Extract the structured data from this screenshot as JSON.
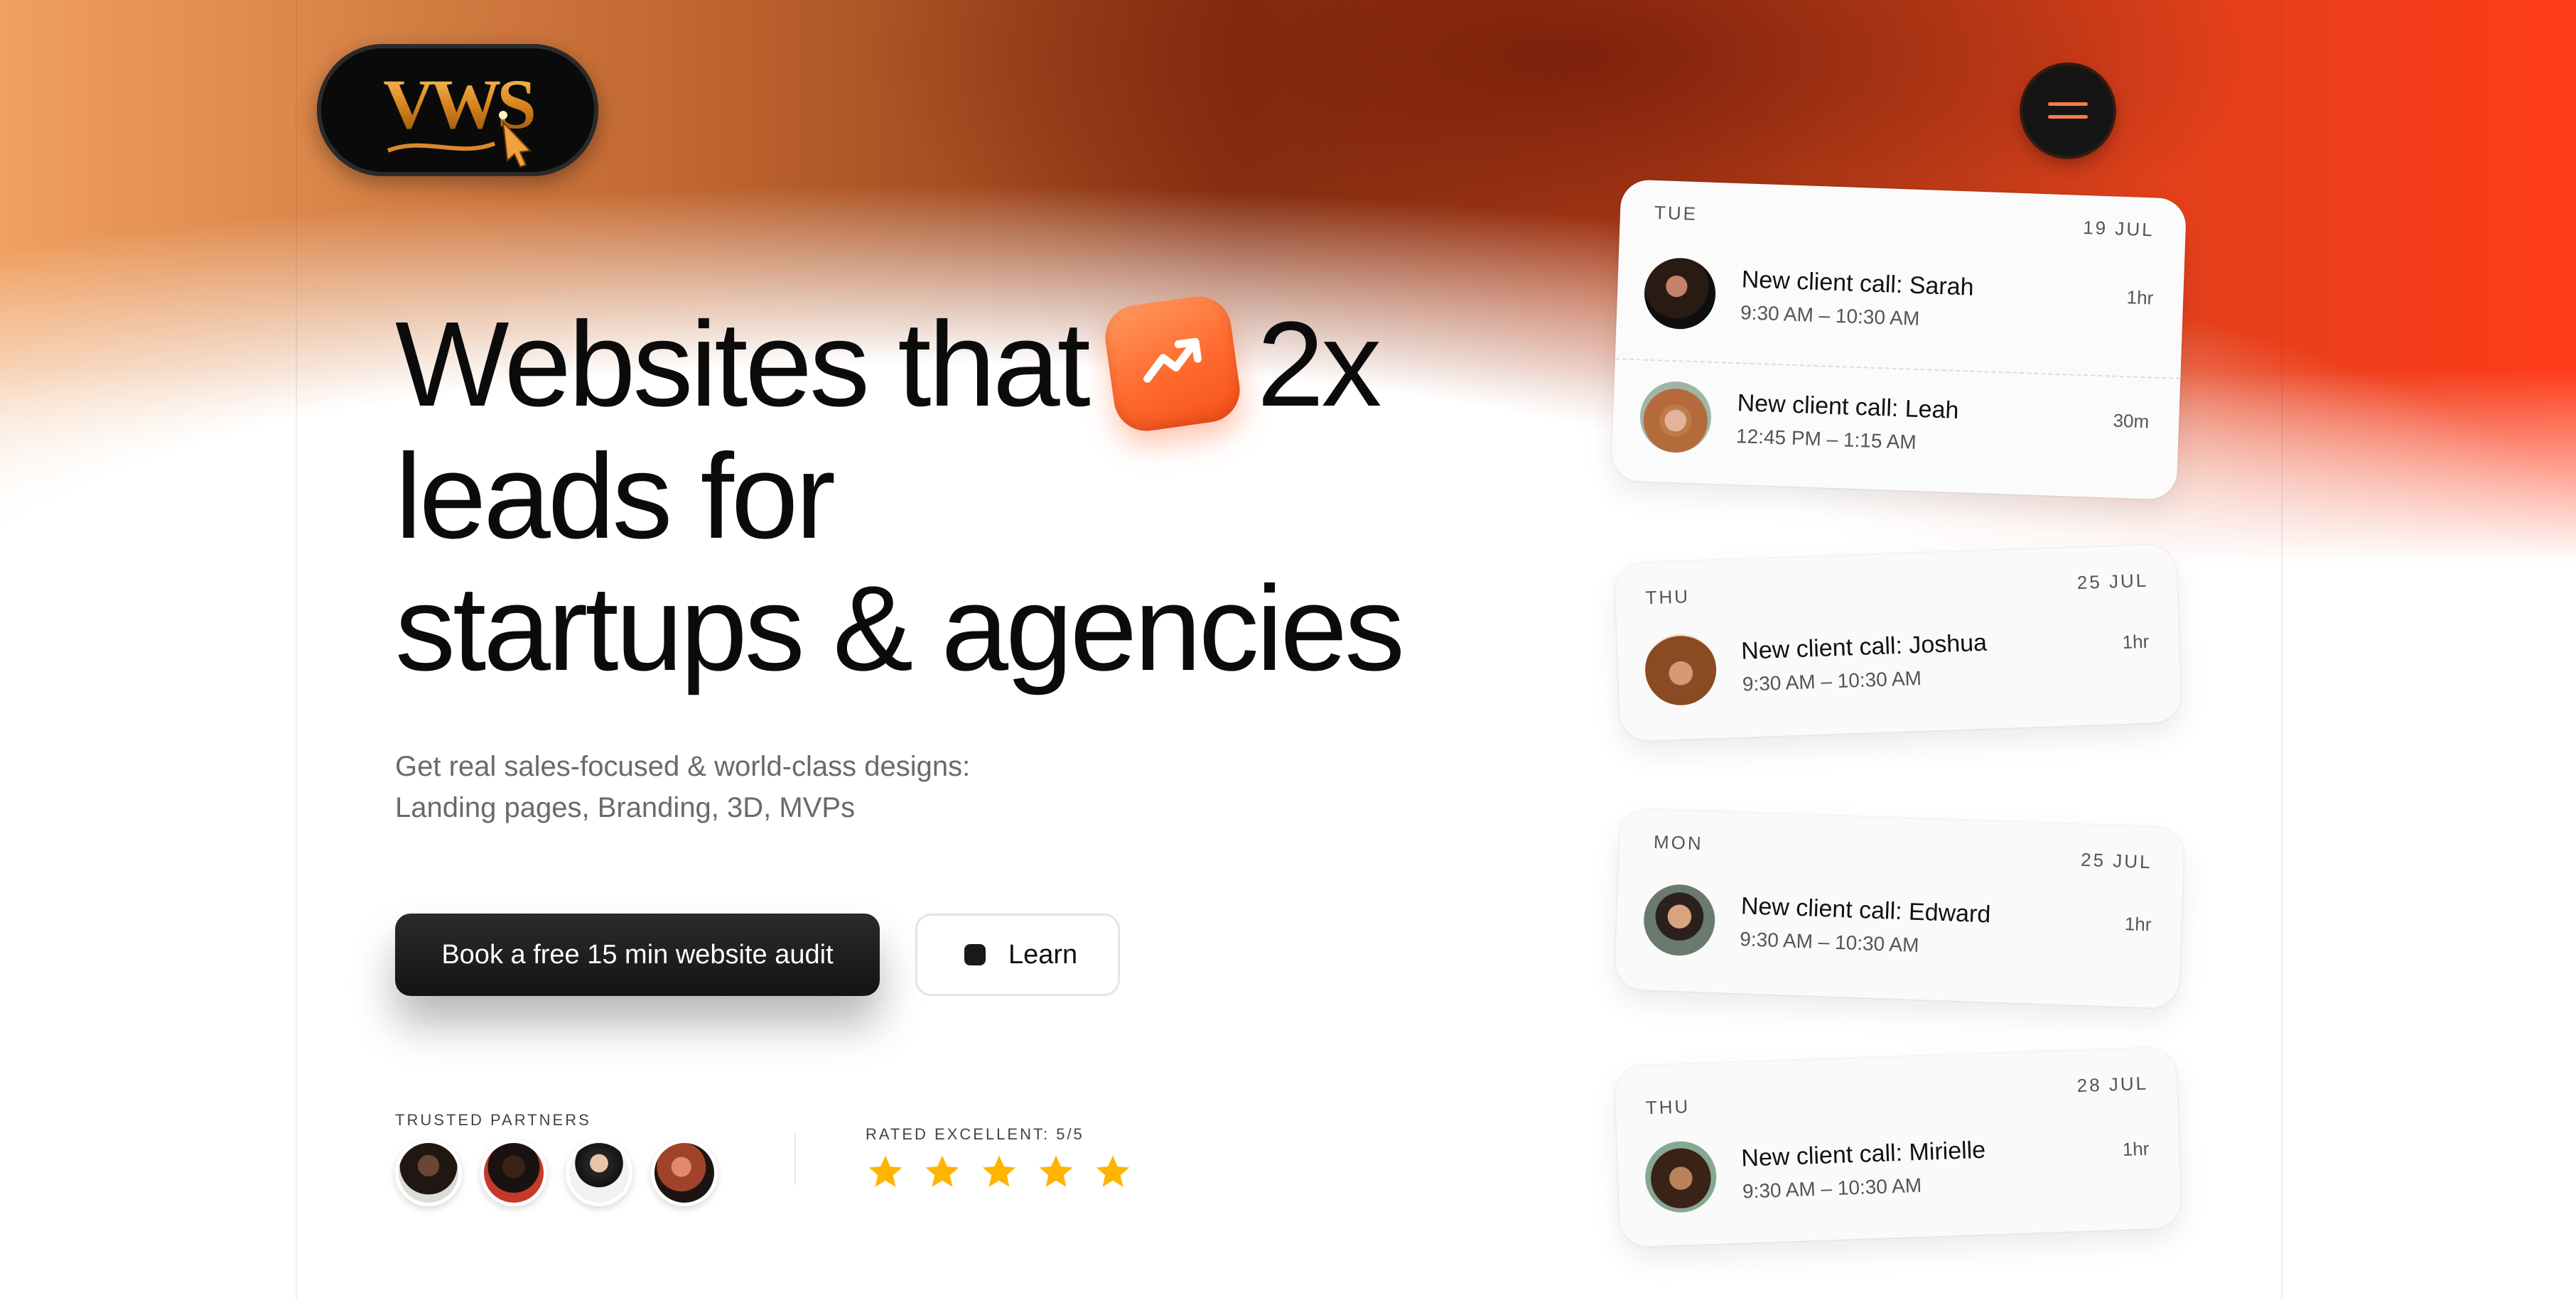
{
  "brand": {
    "logo_text": "VWS"
  },
  "header": {
    "menu_icon": "hamburger-icon"
  },
  "hero": {
    "line1_a": "Websites that",
    "line1_icon": "trending-up-icon",
    "line1_b": "2x",
    "line2": "leads for",
    "line3": "startups & agencies",
    "sub1": "Get real sales-focused & world-class designs:",
    "sub2": "Landing pages, Branding, 3D, MVPs"
  },
  "actions": {
    "primary": "Book a free 15 min website audit",
    "secondary": "Learn"
  },
  "trust": {
    "partners_label": "TRUSTED PARTNERS",
    "rating_label": "RATED EXCELLENT: 5/5",
    "rating": 5,
    "rating_max": 5
  },
  "schedule": [
    {
      "day": "TUE",
      "date": "19 JUL",
      "events": [
        {
          "title": "New client call: Sarah",
          "time": "9:30 AM – 10:30 AM",
          "duration": "1hr"
        },
        {
          "title": "New client call: Leah",
          "time": "12:45 PM – 1:15 AM",
          "duration": "30m"
        }
      ]
    },
    {
      "day": "THU",
      "date": "25 JUL",
      "events": [
        {
          "title": "New client call: Joshua",
          "time": "9:30 AM – 10:30 AM",
          "duration": "1hr"
        }
      ]
    },
    {
      "day": "MON",
      "date": "25 JUL",
      "events": [
        {
          "title": "New client call: Edward",
          "time": "9:30 AM – 10:30 AM",
          "duration": "1hr"
        }
      ]
    },
    {
      "day": "THU",
      "date": "28 JUL",
      "events": [
        {
          "title": "New client call: Mirielle",
          "time": "9:30 AM – 10:30 AM",
          "duration": "1hr"
        }
      ]
    }
  ],
  "colors": {
    "accent": "#ff6a2e",
    "dark": "#141414",
    "star": "#ffb400"
  }
}
